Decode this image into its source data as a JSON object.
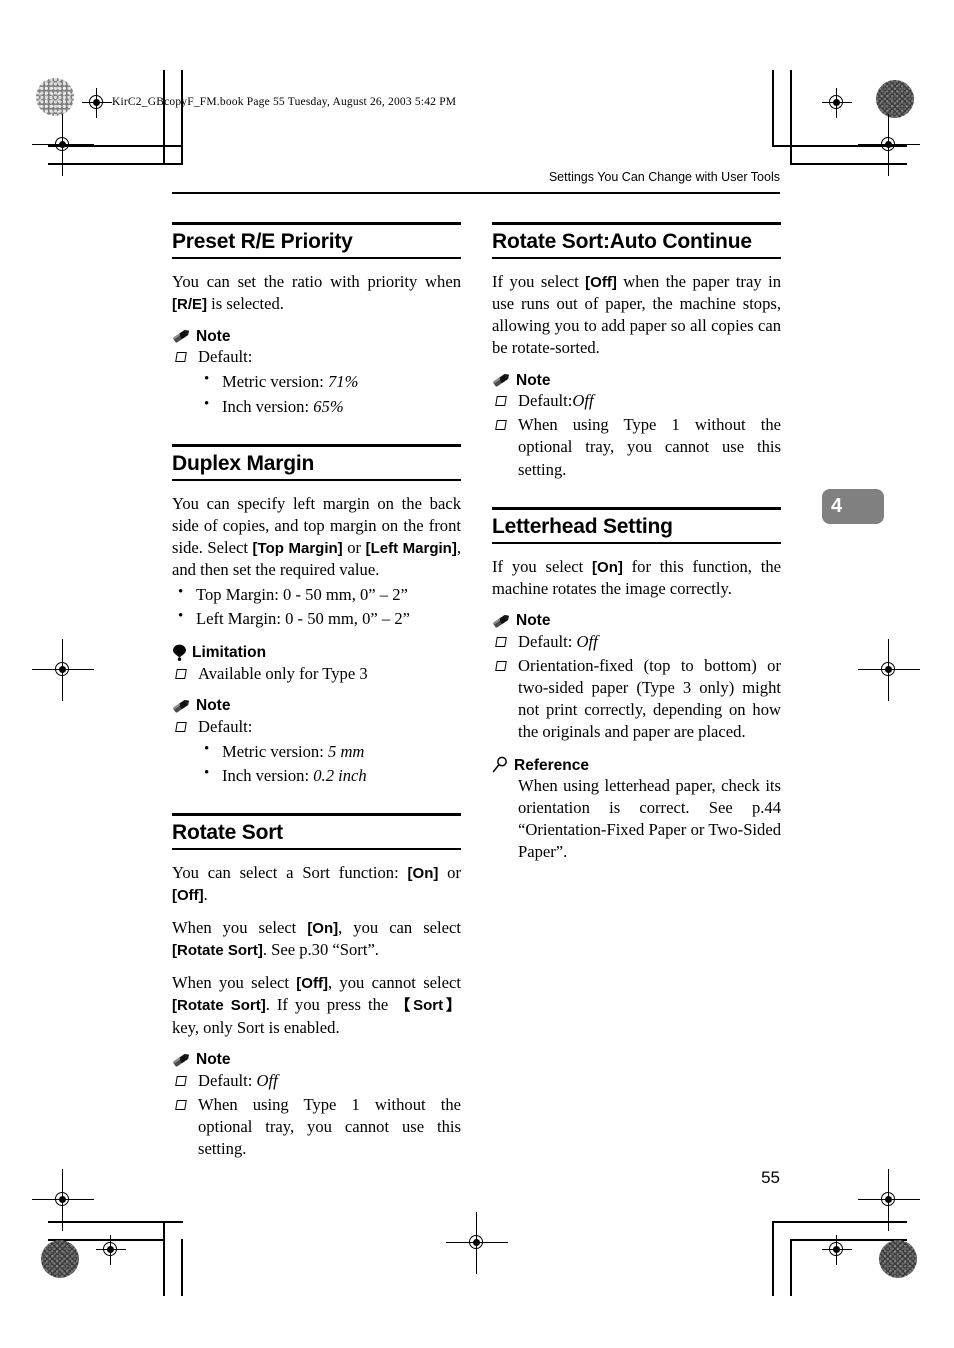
{
  "print_info": "KirC2_GBcopyF_FM.book  Page 55  Tuesday, August 26, 2003  5:42 PM",
  "running_head": "Settings You Can Change with User Tools",
  "chapter_tab": "4",
  "folio": "55",
  "callout_labels": {
    "note": "Note",
    "limitation": "Limitation",
    "reference": "Reference"
  },
  "left_column": {
    "sections": [
      {
        "title": "Preset R/E Priority",
        "body": [
          "You can set the ratio with priority when [R/E] is selected."
        ],
        "note_items": [
          "Default:"
        ],
        "note_sub": [
          "Metric version:  71%",
          "Inch version:  65%"
        ]
      },
      {
        "title": "Duplex Margin",
        "body": [
          "You can specify left margin on the back side of copies, and top margin on the front side. Select [Top Margin] or [Left Margin], and then set the required value."
        ],
        "bullets": [
          "Top Margin: 0 - 50 mm, 0” – 2”",
          "Left Margin: 0 - 50 mm, 0” – 2”"
        ],
        "limitation_items": [
          "Available only for Type 3"
        ],
        "note_items": [
          "Default:"
        ],
        "note_sub": [
          "Metric version: 5 mm",
          "Inch version: 0.2 inch"
        ]
      },
      {
        "title": "Rotate Sort",
        "body": [
          "You can select a Sort function: [On] or [Off].",
          "When you select [On], you can select [Rotate Sort]. See p.30 “Sort”.",
          "When you select [Off], you cannot select [Rotate Sort]. If you press the {Sort} key, only Sort is enabled."
        ],
        "note_items": [
          "Default: Off",
          "When using Type 1 without the optional tray, you cannot use this setting."
        ]
      }
    ]
  },
  "right_column": {
    "sections": [
      {
        "title": "Rotate Sort:Auto Continue",
        "body": [
          "If you select [Off] when the paper tray in use runs out of paper, the machine stops, allowing you to add paper so all copies can be rotate-sorted."
        ],
        "note_items": [
          "Default:Off",
          "When using Type 1 without the optional tray, you cannot use this setting."
        ]
      },
      {
        "title": "Letterhead Setting",
        "body": [
          "If you select [On] for this function, the machine rotates the image correctly."
        ],
        "note_items": [
          "Default: Off",
          "Orientation-fixed (top to bottom) or two-sided paper (Type 3 only) might not print correctly, depending on how the originals and paper are placed."
        ],
        "reference_body": "When using letterhead paper, check its orientation is correct. See p.44 “Orientation-Fixed Paper or Two-Sided Paper”."
      }
    ]
  },
  "text_fragments": {
    "preset_body_a": "You can set the ratio with priority when ",
    "preset_kb_re": "[R/E]",
    "preset_body_b": " is selected.",
    "default_label": "Default:",
    "metric_71": "Metric version: ",
    "metric_71_val": "71%",
    "inch_65": "Inch version: ",
    "inch_65_val": "65%",
    "duplex_body_a": "You can specify left margin on the back side of copies, and top margin on the front side. Select ",
    "duplex_kb_top": "[Top Margin]",
    "duplex_body_b": " or ",
    "duplex_kb_left": "[Left Margin]",
    "duplex_body_c": ", and then set the required value.",
    "duplex_bullet_top": "Top Margin: 0 - 50 mm, 0” – 2”",
    "duplex_bullet_left": "Left Margin: 0 - 50 mm, 0” – 2”",
    "duplex_limitation": "Available only for Type 3",
    "metric_5mm": "Metric version: ",
    "metric_5mm_val": "5 mm",
    "inch_02": "Inch version: ",
    "inch_02_val": "0.2 inch",
    "rs_p1_a": "You can select a Sort function: ",
    "rs_p1_kb_on": "[On]",
    "rs_p1_b": " or ",
    "rs_p1_kb_off": "[Off]",
    "rs_p1_c": ".",
    "rs_p2_a": "When you select ",
    "rs_p2_kb_on": "[On]",
    "rs_p2_b": ", you can select ",
    "rs_p2_kb_rotate": "[Rotate Sort]",
    "rs_p2_c": ". See p.30 “Sort”.",
    "rs_p3_a": "When you select ",
    "rs_p3_kb_off": "[Off]",
    "rs_p3_b": ", you cannot select ",
    "rs_p3_kb_rotate": "[Rotate Sort]",
    "rs_p3_c": ". If you press the ",
    "rs_p3_kb_sort": "【Sort】",
    "rs_p3_d": " key, only Sort is enabled.",
    "rs_default": "Default: ",
    "rs_default_val": "Off",
    "rs_note2": "When using Type 1 without the optional tray, you cannot use this setting.",
    "rsac_a": "If you select ",
    "rsac_kb_off": "[Off]",
    "rsac_b": " when the paper tray in use runs out of paper, the machine stops, allowing you to add paper so all copies can be rotate-sorted.",
    "rsac_default": "Default:",
    "rsac_default_val": "Off",
    "rsac_note2": "When using Type 1 without the optional tray, you cannot use this setting.",
    "lh_a": "If you select ",
    "lh_kb_on": "[On]",
    "lh_b": " for this function, the machine rotates the image correctly.",
    "lh_default": "Default: ",
    "lh_default_val": "Off",
    "lh_note2": "Orientation-fixed (top to bottom) or two-sided paper (Type 3 only) might not print correctly, depending on how the originals and paper are placed.",
    "lh_reference": "When using letterhead paper, check its orientation is correct. See p.44 “Orientation-Fixed Paper or Two-Sided Paper”."
  }
}
